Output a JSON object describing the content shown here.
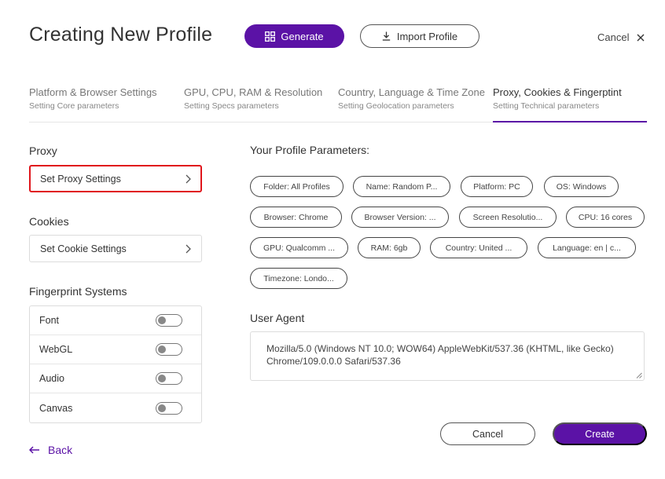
{
  "header": {
    "title": "Creating New Profile",
    "generate_label": "Generate",
    "import_label": "Import Profile",
    "cancel_label": "Cancel"
  },
  "tabs": [
    {
      "title": "Platform & Browser Settings",
      "subtitle": "Setting Core parameters",
      "active": false
    },
    {
      "title": "GPU, CPU, RAM & Resolution",
      "subtitle": "Setting Specs parameters",
      "active": false
    },
    {
      "title": "Country, Language & Time Zone",
      "subtitle": "Setting Geolocation parameters",
      "active": false
    },
    {
      "title": "Proxy, Cookies & Fingerptint",
      "subtitle": "Setting Technical parameters",
      "active": true
    }
  ],
  "proxy": {
    "label": "Proxy",
    "button_label": "Set Proxy Settings"
  },
  "cookies": {
    "label": "Cookies",
    "button_label": "Set Cookie Settings"
  },
  "fingerprint": {
    "label": "Fingerprint Systems",
    "items": [
      {
        "label": "Font",
        "on": false
      },
      {
        "label": "WebGL",
        "on": false
      },
      {
        "label": "Audio",
        "on": false
      },
      {
        "label": "Canvas",
        "on": false
      }
    ]
  },
  "params": {
    "title": "Your Profile Parameters:",
    "chips": [
      "Folder: All Profiles",
      "Name: Random P...",
      "Platform: PC",
      "OS: Windows",
      "Browser: Chrome",
      "Browser Version: ...",
      "Screen Resolutio...",
      "CPU: 16 cores",
      "GPU: Qualcomm ...",
      "RAM: 6gb",
      "Country: United ...",
      "Language: en | c...",
      "Timezone: Londo..."
    ]
  },
  "user_agent": {
    "label": "User Agent",
    "value": "Mozilla/5.0 (Windows NT 10.0; WOW64) AppleWebKit/537.36 (KHTML, like Gecko) Chrome/109.0.0.0 Safari/537.36"
  },
  "footer": {
    "back_label": "Back",
    "cancel_label": "Cancel",
    "create_label": "Create"
  },
  "colors": {
    "accent": "#5b12a6",
    "highlight": "#e0161c"
  }
}
